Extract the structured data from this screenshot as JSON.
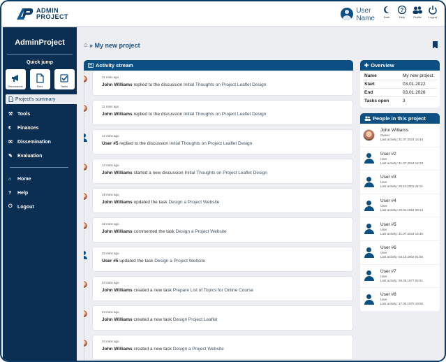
{
  "app": {
    "logo_line1": "ADMIN",
    "logo_line2": "PROJECT",
    "user_line1": "User",
    "user_line2": "Name"
  },
  "top_icons": [
    {
      "icon": "moon-icon",
      "label": "Dark"
    },
    {
      "icon": "help-icon",
      "label": "Help"
    },
    {
      "icon": "people-icon",
      "label": "Profile"
    },
    {
      "icon": "power-icon",
      "label": "Logout"
    }
  ],
  "sidebar": {
    "title": "AdminProject",
    "quick_jump": "Quick jump",
    "quick": [
      {
        "label": "Discussions",
        "icon": "megaphone-icon"
      },
      {
        "label": "Files",
        "icon": "file-icon"
      },
      {
        "label": "Tasks",
        "icon": "task-icon"
      }
    ],
    "summary": "Project's summary",
    "nav": [
      {
        "label": "Tools",
        "glyph": "⚒"
      },
      {
        "label": "Finances",
        "glyph": "€"
      },
      {
        "label": "Dissemination",
        "glyph": "✉"
      },
      {
        "label": "Evaluation",
        "glyph": "✎"
      }
    ],
    "nav2": [
      {
        "label": "Home",
        "glyph": "⌂"
      },
      {
        "label": "Help",
        "glyph": "?"
      },
      {
        "label": "Logout",
        "glyph": "⏻"
      }
    ]
  },
  "page": {
    "home_glyph": "⌂",
    "breadcrumb": "» My new project"
  },
  "stream": {
    "title": "Activity stream",
    "items": [
      {
        "avatar": "photo",
        "time": "11 mins ago",
        "who": "John Williams",
        "action": " replied to the discussion ",
        "object": "Initial Thoughts on Project Leaflet Design"
      },
      {
        "avatar": "photo",
        "time": "11 mins ago",
        "who": "John Williams",
        "action": " replied to the discussion ",
        "object": "Initial Thoughts on Project Leaflet Design"
      },
      {
        "avatar": "user",
        "time": "12 mins ago",
        "who": "User #5",
        "action": " replied to the discussion ",
        "object": "Initial Thoughts on Project Leaflet Design"
      },
      {
        "avatar": "photo",
        "time": "14 mins ago",
        "who": "John Williams",
        "action": " started a new discussion ",
        "object": "Initial Thoughts on Project Leaflet Design"
      },
      {
        "avatar": "photo",
        "time": "18 mins ago",
        "who": "John Williams",
        "action": " updated the task ",
        "object": "Design a Project Website"
      },
      {
        "avatar": "photo",
        "time": "18 mins ago",
        "who": "John Williams",
        "action": " commented the task ",
        "object": "Design a Project Website"
      },
      {
        "avatar": "user",
        "time": "22 mins ago",
        "who": "User #5",
        "action": " updated the task ",
        "object": "Design a Project Website"
      },
      {
        "avatar": "photo",
        "time": "24 mins ago",
        "who": "John Williams",
        "action": " created a new task ",
        "object": "Prepare List of Topics for Online Course"
      },
      {
        "avatar": "photo",
        "time": "24 mins ago",
        "who": "John Williams",
        "action": " created a new task ",
        "object": "Design Project Leaflet"
      },
      {
        "avatar": "photo",
        "time": "24 mins ago",
        "who": "John Williams",
        "action": " created a new task ",
        "object": "Design a Project Website"
      }
    ]
  },
  "overview": {
    "title": "Overview",
    "rows": [
      {
        "key": "Name",
        "value": "My new project"
      },
      {
        "key": "Start",
        "value": "03.01.2022"
      },
      {
        "key": "End",
        "value": "03.01.2026"
      },
      {
        "key": "Tasks open",
        "value": "3"
      }
    ]
  },
  "people": {
    "title": "People in this project",
    "items": [
      {
        "avatar": "photo",
        "name": "John Williams",
        "role": "Owner",
        "last": "Last activity: 31.07.2024 14:44"
      },
      {
        "avatar": "user",
        "name": "User #2",
        "role": "User",
        "last": "Last activity: 31.07.2024 14:23"
      },
      {
        "avatar": "user",
        "name": "User #3",
        "role": "User",
        "last": "Last activity: 20.11.2001 03:14"
      },
      {
        "avatar": "user",
        "name": "User #4",
        "role": "User",
        "last": "Last activity: 20.01.1984 09:14"
      },
      {
        "avatar": "user",
        "name": "User #5",
        "role": "User",
        "last": "Last activity: 31.07.2024 14:46"
      },
      {
        "avatar": "user",
        "name": "User #6",
        "role": "User",
        "last": "Last activity: 03.10.2002 01:56"
      },
      {
        "avatar": "user",
        "name": "User #7",
        "role": "User",
        "last": "Last activity: 09.08.1977 02:51"
      },
      {
        "avatar": "user",
        "name": "User #8",
        "role": "User",
        "last": "Last activity: 17.03.1970 19:56"
      }
    ]
  },
  "colors": {
    "navy": "#0b2f52",
    "accent": "#0b4f83"
  }
}
